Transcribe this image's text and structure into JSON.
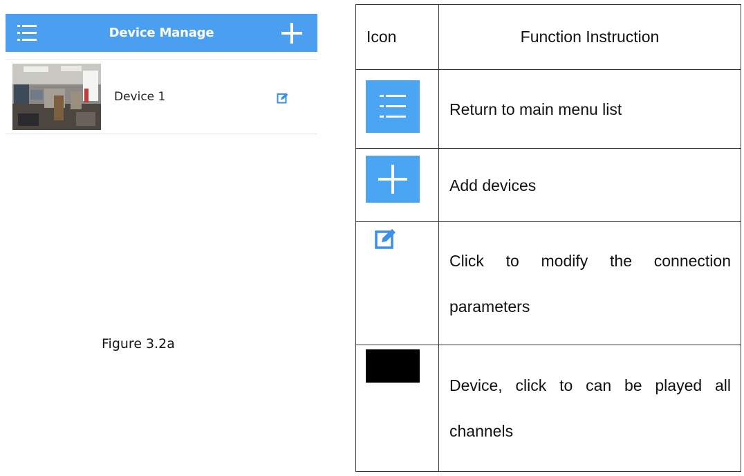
{
  "app": {
    "title": "Device Manage",
    "menu_icon": "menu-list-icon",
    "add_icon": "plus-icon",
    "accent_color": "#4a9ff0"
  },
  "devices": [
    {
      "name": "Device 1",
      "thumbnail": "office-camera-thumbnail",
      "edit_icon": "edit-icon"
    }
  ],
  "caption": "Figure 3.2a",
  "table": {
    "headers": [
      "Icon",
      "Function Instruction"
    ],
    "rows": [
      {
        "icon": "menu-list-icon",
        "text": "Return to main menu list"
      },
      {
        "icon": "plus-icon",
        "text": "Add devices"
      },
      {
        "icon": "edit-icon",
        "text": "Click to modify the connection parameters"
      },
      {
        "icon": "black-device-box-icon",
        "text": "Device, click to can be played all channels"
      }
    ]
  }
}
